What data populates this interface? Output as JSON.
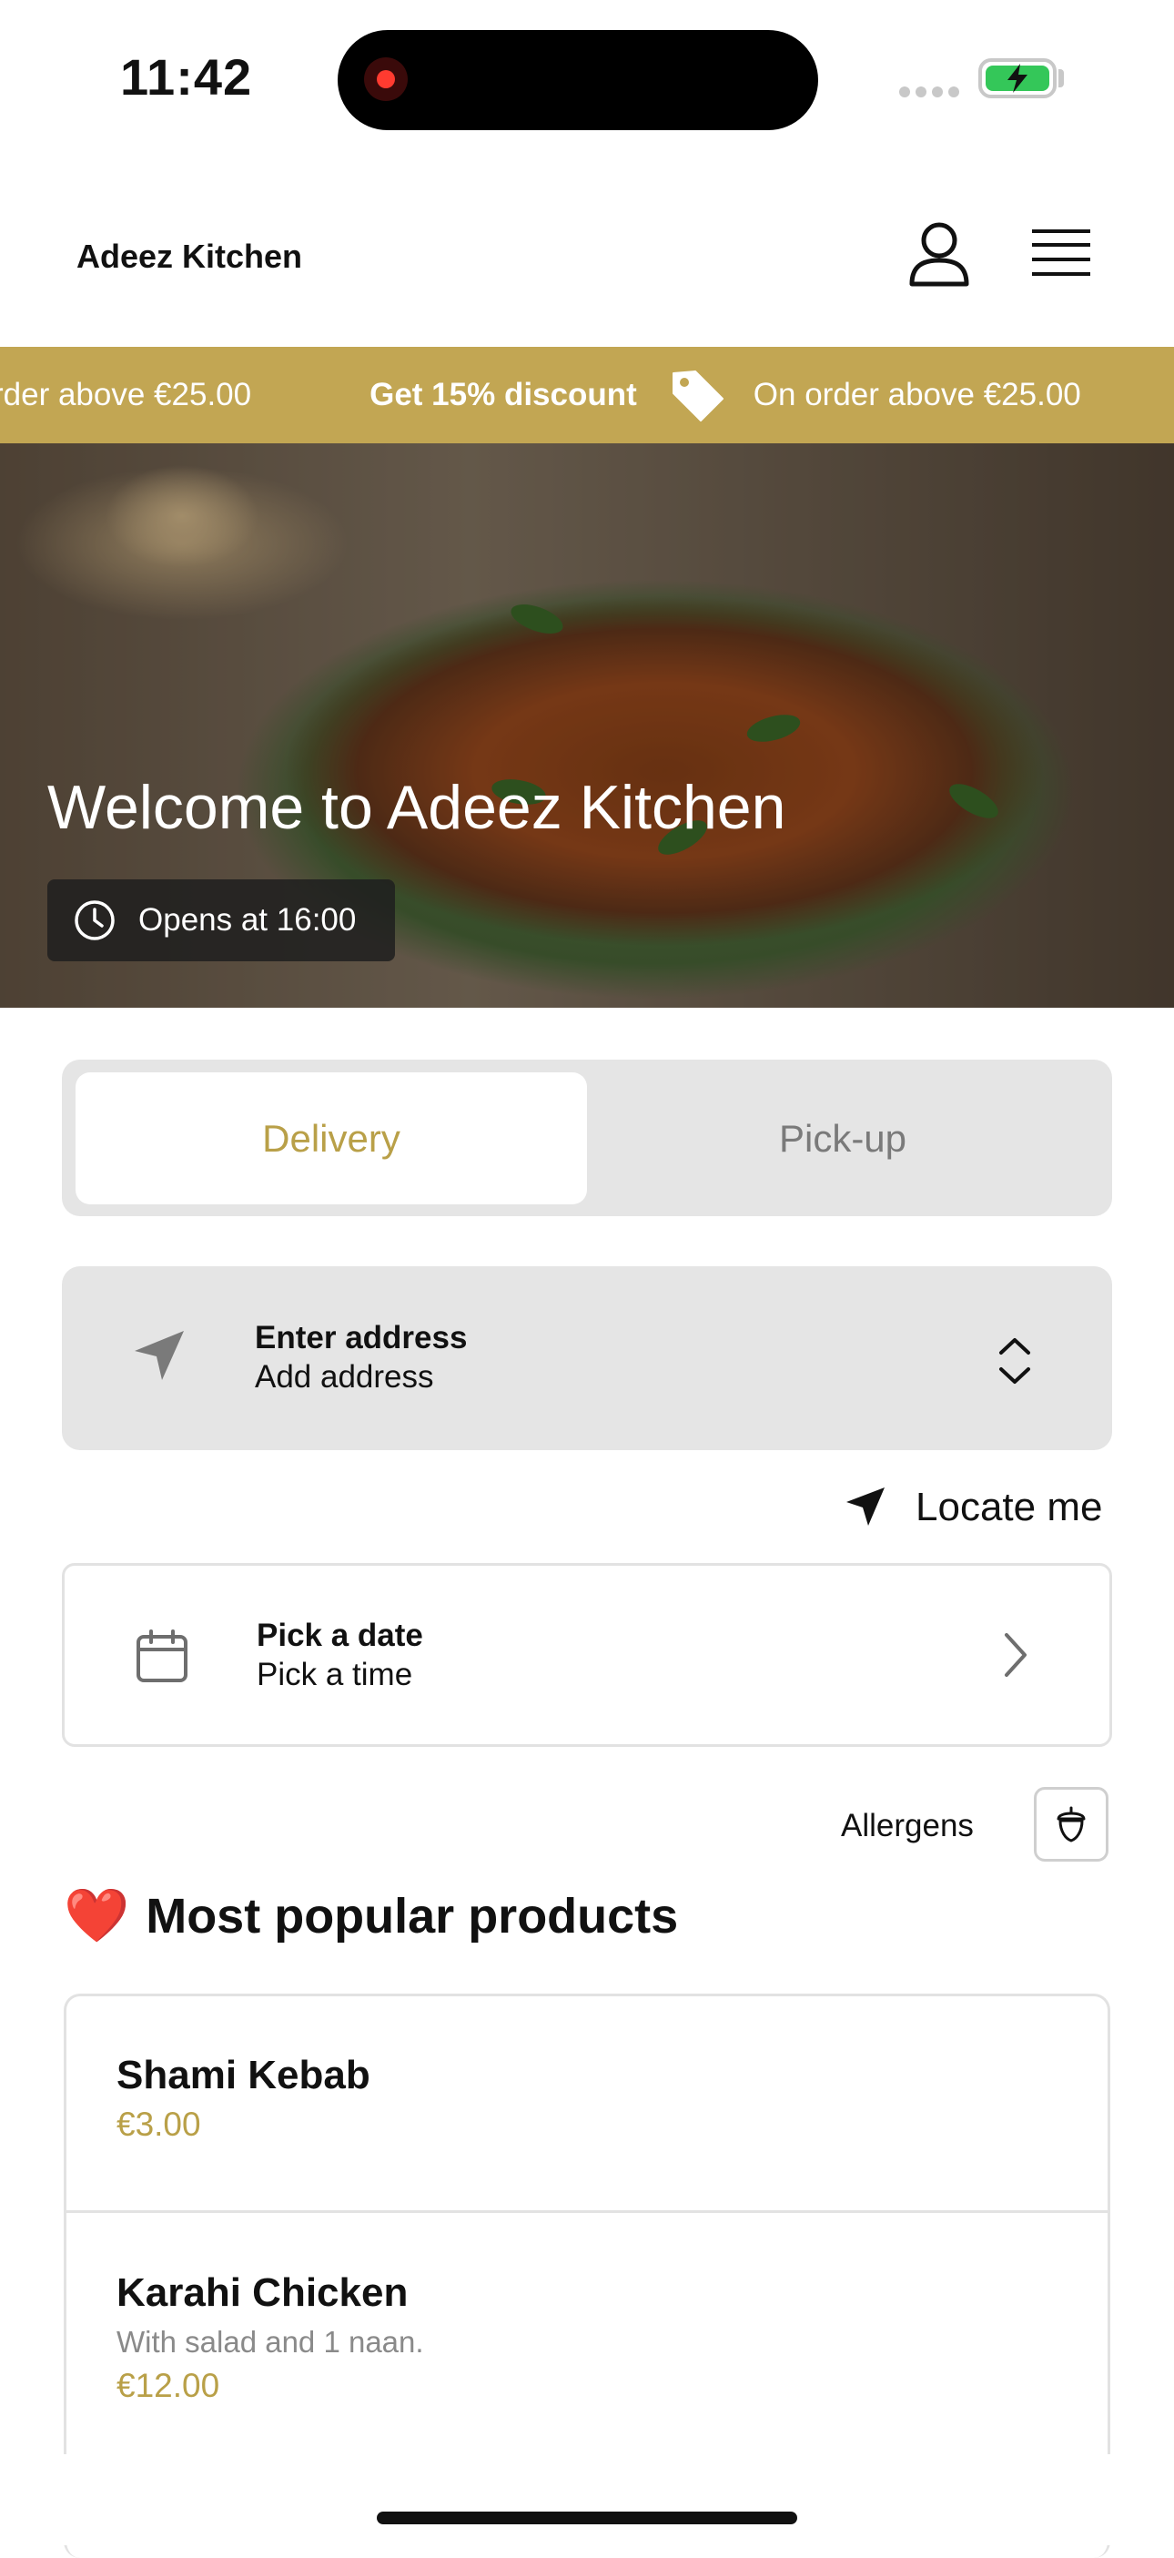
{
  "status_bar": {
    "time": "11:42"
  },
  "header": {
    "brand": "Adeez Kitchen"
  },
  "banner": {
    "partial_text": "rder above €25.00",
    "discount_text": "Get 15% discount",
    "condition_text": "On order above €25.00",
    "accent_color": "#c2a653"
  },
  "hero": {
    "title": "Welcome to Adeez Kitchen",
    "opens_text": "Opens at 16:00"
  },
  "mode_toggle": {
    "options": [
      "Delivery",
      "Pick-up"
    ],
    "selected": "Delivery"
  },
  "address": {
    "title": "Enter address",
    "subtitle": "Add address"
  },
  "locate": {
    "label": "Locate me"
  },
  "date_picker": {
    "title": "Pick a date",
    "subtitle": "Pick a time"
  },
  "allergens": {
    "label": "Allergens"
  },
  "popular": {
    "title": "Most popular products",
    "emoji": "❤️",
    "items": [
      {
        "name": "Shami Kebab",
        "description": "",
        "price": "€3.00"
      },
      {
        "name": "Karahi Chicken",
        "description": "With salad and 1 naan.",
        "price": "€12.00"
      }
    ]
  },
  "colors": {
    "gold": "#b9a048",
    "surface": "#e5e5e5"
  }
}
